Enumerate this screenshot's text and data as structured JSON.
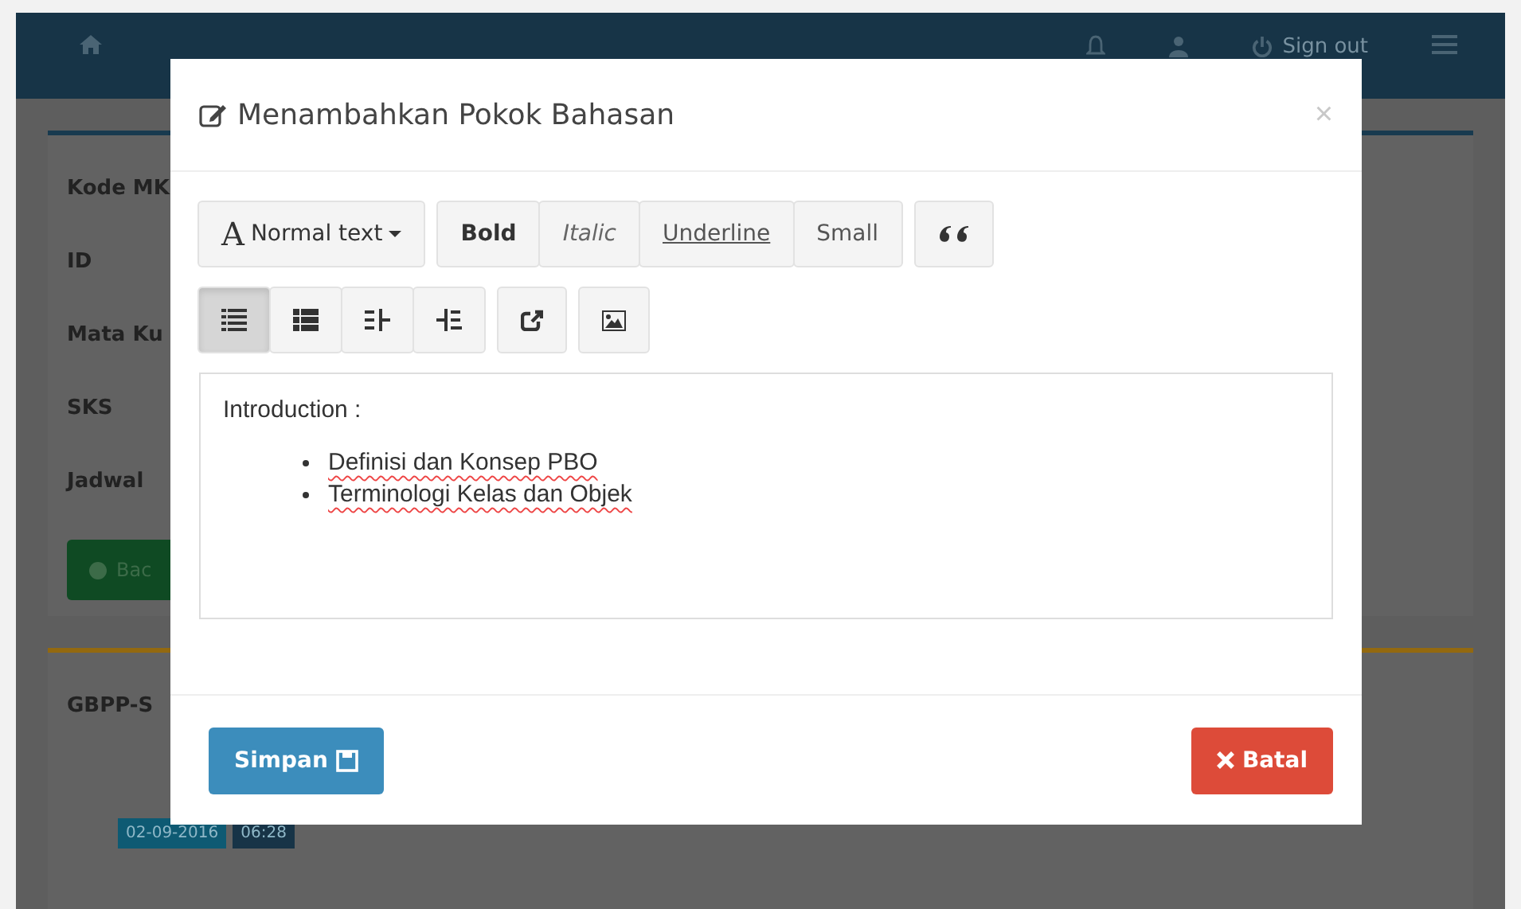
{
  "navbar": {
    "sign_out": "Sign out"
  },
  "info_panel": {
    "labels": [
      "Kode MK",
      "ID",
      "Mata Ku",
      "SKS",
      "Jadwal"
    ],
    "back_button": "Bac"
  },
  "gbpp_panel": {
    "title": "GBPP-S",
    "date": "02-09-2016",
    "time": "06:28"
  },
  "modal": {
    "title": "Menambahkan Pokok Bahasan",
    "close": "×",
    "style_icon": "A",
    "style_dropdown": "Normal text",
    "format_buttons": [
      {
        "label": "Bold",
        "kind": "bold"
      },
      {
        "label": "Italic",
        "kind": "italic"
      },
      {
        "label": "Underline",
        "kind": "underline"
      },
      {
        "label": "Small",
        "kind": "small"
      }
    ],
    "list_buttons": [
      {
        "kind": "bullets",
        "selected": true
      },
      {
        "kind": "numbers",
        "selected": false
      },
      {
        "kind": "outdent",
        "selected": false
      },
      {
        "kind": "indent",
        "selected": false
      }
    ],
    "editor": {
      "heading": "Introduction :",
      "items": [
        "Definisi dan Konsep PBO",
        "Terminologi Kelas dan Objek"
      ]
    },
    "save_button": "Simpan",
    "cancel_button": "Batal"
  }
}
